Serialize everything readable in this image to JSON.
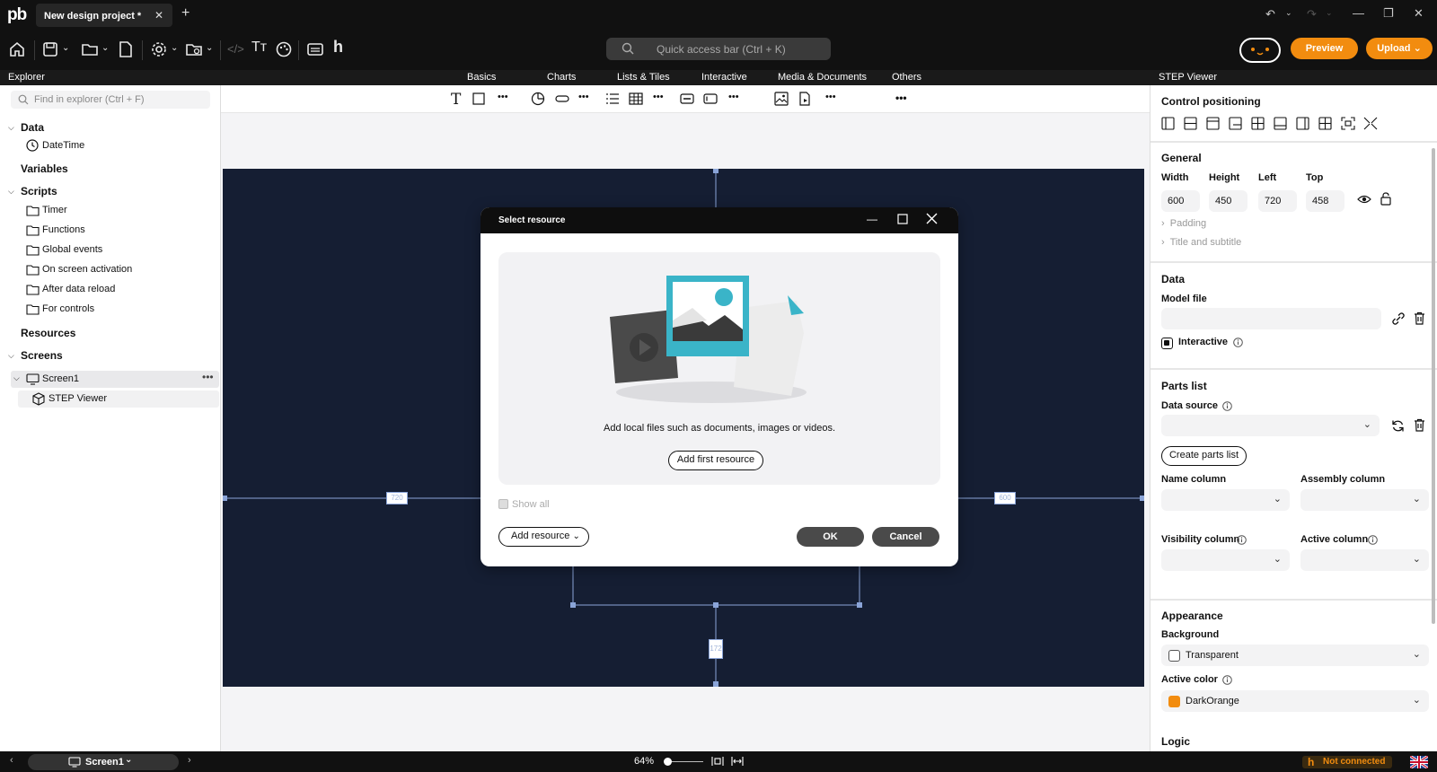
{
  "titlebar": {
    "logo": "pb",
    "tab_title": "New design project *",
    "tab_close": "✕",
    "tab_add": "+"
  },
  "toolbar": {
    "quick_access_placeholder": "Quick access bar (Ctrl + K)",
    "preview_label": "Preview",
    "upload_label": "Upload"
  },
  "header_row": {
    "explorer": "Explorer",
    "categories": [
      "Basics",
      "Charts",
      "Lists & Tiles",
      "Interactive",
      "Media & Documents",
      "Others"
    ],
    "right_panel": "STEP Viewer"
  },
  "explorer": {
    "search_placeholder": "Find in explorer (Ctrl + F)",
    "data": {
      "label": "Data",
      "items": [
        "DateTime"
      ]
    },
    "variables": {
      "label": "Variables"
    },
    "scripts": {
      "label": "Scripts",
      "items": [
        "Timer",
        "Functions",
        "Global events",
        "On screen activation",
        "After data reload",
        "For controls"
      ]
    },
    "resources": {
      "label": "Resources"
    },
    "screens": {
      "label": "Screens",
      "screen": "Screen1",
      "child": "STEP Viewer"
    }
  },
  "canvas": {
    "measure_left": "720",
    "measure_right": "600",
    "measure_bottom": "172"
  },
  "dialog": {
    "title": "Select resource",
    "description": "Add local files such as documents, images or videos.",
    "add_first_label": "Add first resource",
    "show_all_label": "Show all",
    "add_resource_label": "Add resource",
    "ok_label": "OK",
    "cancel_label": "Cancel"
  },
  "right_panel": {
    "control_positioning": "Control positioning",
    "general": {
      "title": "General",
      "width_label": "Width",
      "width_value": "600",
      "height_label": "Height",
      "height_value": "450",
      "left_label": "Left",
      "left_value": "720",
      "top_label": "Top",
      "top_value": "458",
      "padding_label": "Padding",
      "title_subtitle_label": "Title and subtitle"
    },
    "data": {
      "title": "Data",
      "model_file_label": "Model file",
      "interactive_label": "Interactive"
    },
    "parts_list": {
      "title": "Parts list",
      "data_source_label": "Data source",
      "create_label": "Create parts list",
      "name_column_label": "Name column",
      "assembly_column_label": "Assembly column",
      "visibility_column_label": "Visibility column",
      "active_column_label": "Active column"
    },
    "appearance": {
      "title": "Appearance",
      "background_label": "Background",
      "background_value": "Transparent",
      "active_color_label": "Active color",
      "active_color_value": "DarkOrange",
      "active_color_hex": "#f28c0f"
    },
    "logic": {
      "title": "Logic"
    }
  },
  "statusbar": {
    "screen_name": "Screen1",
    "zoom": "64%",
    "zoom_level": 0.1,
    "connection_status": "Not connected"
  },
  "colors": {
    "accent": "#f28c0f",
    "canvas_dark": "#151e33",
    "chrome": "#111111"
  }
}
